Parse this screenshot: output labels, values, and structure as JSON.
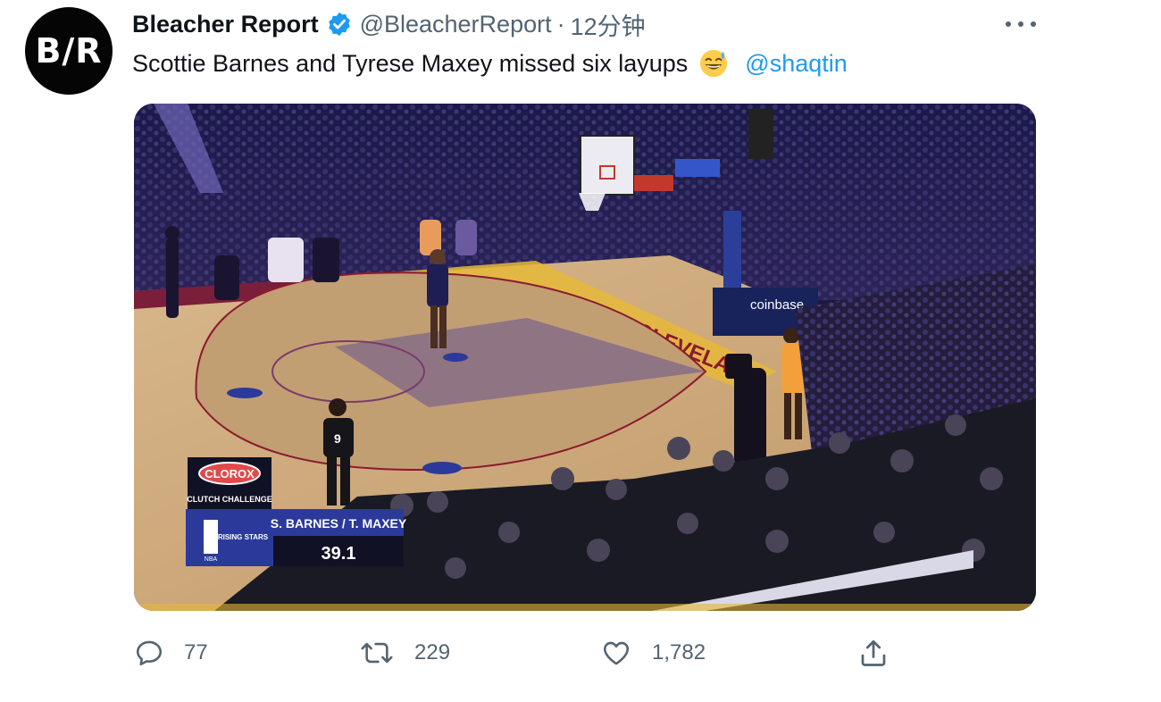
{
  "tweet": {
    "avatar_text": "B/R",
    "display_name": "Bleacher Report",
    "handle": "@BleacherReport",
    "separator": "·",
    "time": "12分钟",
    "text": "Scottie Barnes and Tyrese Maxey missed six layups",
    "emoji": "grinning-sweat-emoji",
    "mention": "@shaqtin"
  },
  "media": {
    "scoreboard": {
      "sponsor": "CLOROX",
      "event": "CLUTCH CHALLENGE",
      "league_logo": "NBA",
      "game_logo": "RISING STARS",
      "players": "S. BARNES / T. MAXEY",
      "clock": "39.1"
    },
    "arena_signage": {
      "baseline": "CLEVELAND",
      "stanchion": "coinbase"
    },
    "referee_number": "9"
  },
  "actions": {
    "replies": "77",
    "retweets": "229",
    "likes": "1,782"
  },
  "colors": {
    "accent": "#1d9bf0",
    "text_primary": "#0f1419",
    "text_secondary": "#536471",
    "court_wood": "#c9a47a",
    "court_paint": "#8a6f86"
  },
  "icons": {
    "verified": "verified-badge-icon",
    "more": "more-icon",
    "reply": "reply-icon",
    "retweet": "retweet-icon",
    "like": "heart-icon",
    "share": "share-icon"
  }
}
